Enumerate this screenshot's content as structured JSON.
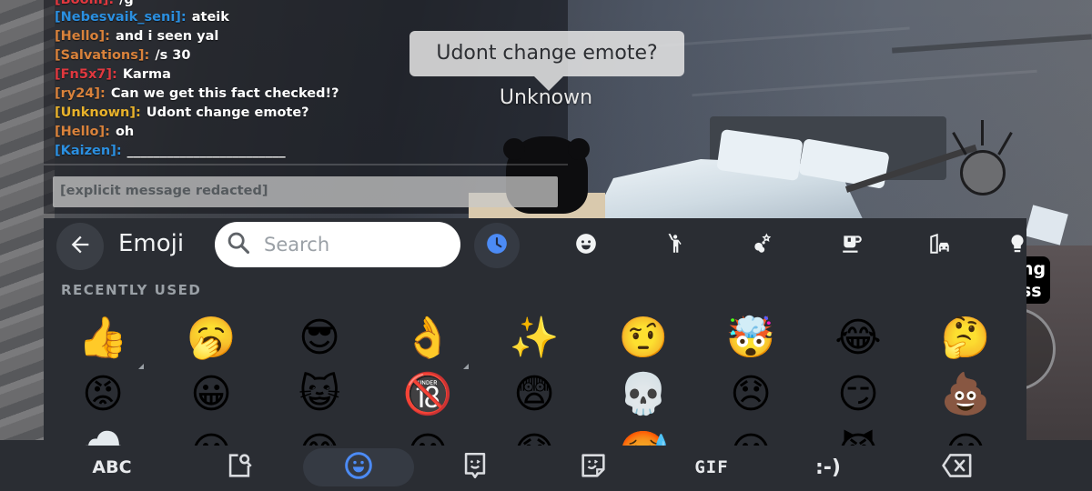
{
  "chat": {
    "lines": [
      {
        "name": "[Boom]:",
        "name_color": "#e0383f",
        "message": "/g"
      },
      {
        "name": "[Nebesvaik_seni]:",
        "name_color": "#2b8fe0",
        "message": "ateik"
      },
      {
        "name": "[Hello]:",
        "name_color": "#d9823b",
        "message": "and i seen yal"
      },
      {
        "name": "[Salvations]:",
        "name_color": "#d9823b",
        "message": "/s 30"
      },
      {
        "name": "[Fn5x7]:",
        "name_color": "#e0383f",
        "message": "Karma"
      },
      {
        "name": "[ry24]:",
        "name_color": "#d9823b",
        "message": "Can we get this fact checked!?"
      },
      {
        "name": "[Unknown]:",
        "name_color": "#e8b22b",
        "message": "Udont change emote?"
      },
      {
        "name": "[Hello]:",
        "name_color": "#d9823b",
        "message": "oh"
      },
      {
        "name": "[Kaizen]:",
        "name_color": "#2b8fe0",
        "message": "________________________"
      }
    ],
    "input_value": "[explicit message redacted]"
  },
  "overhead": {
    "bubble_text": "Udont change emote?",
    "player_name": "Unknown"
  },
  "side_button": {
    "label_line1": "ng",
    "label_line2": "ss"
  },
  "emoji_panel": {
    "title": "Emoji",
    "back_icon": "arrow-left-icon",
    "search_placeholder": "Search",
    "accent_color": "#4c8bf5",
    "categories": [
      {
        "id": "recent",
        "icon": "clock-icon",
        "active": true
      },
      {
        "id": "smileys",
        "icon": "smiley-icon",
        "active": false
      },
      {
        "id": "people",
        "icon": "person-waving-icon",
        "active": false
      },
      {
        "id": "activities",
        "icon": "party-popper-icon",
        "active": false
      },
      {
        "id": "food",
        "icon": "coffee-cup-icon",
        "active": false
      },
      {
        "id": "travel",
        "icon": "building-car-icon",
        "active": false
      },
      {
        "id": "objects",
        "icon": "lightbulb-icon",
        "active": false
      }
    ],
    "section_label": "RECENTLY USED",
    "emoji_rows": [
      [
        "👍",
        "🥱",
        "😎",
        "👌",
        "✨",
        "🤨",
        "🤯",
        "😂",
        "🤔"
      ],
      [
        "😡",
        "😀",
        "😺",
        "🔞",
        "😨",
        "💀",
        "😞",
        "😏",
        "💩"
      ],
      [
        "🌨️",
        "😀",
        "😅",
        "😀",
        "😰",
        "🥵",
        "😀",
        "😈",
        "😀"
      ]
    ],
    "variant_marked": [
      [
        0,
        0
      ],
      [
        0,
        3
      ]
    ]
  },
  "bottom_bar": {
    "items": [
      {
        "id": "abc",
        "label": "ABC",
        "icon": null,
        "active": false
      },
      {
        "id": "search",
        "label": null,
        "icon": "search-page-icon",
        "active": false
      },
      {
        "id": "emoji",
        "label": null,
        "icon": "emoji-icon",
        "active": true
      },
      {
        "id": "bitmoji",
        "label": null,
        "icon": "bitmoji-icon",
        "active": false
      },
      {
        "id": "stickers",
        "label": null,
        "icon": "sticker-icon",
        "active": false
      },
      {
        "id": "gif",
        "label": "GIF",
        "icon": null,
        "active": false
      },
      {
        "id": "emoticons",
        "label": ":-)",
        "icon": null,
        "active": false
      },
      {
        "id": "backspace",
        "label": null,
        "icon": "backspace-icon",
        "active": false
      }
    ]
  }
}
